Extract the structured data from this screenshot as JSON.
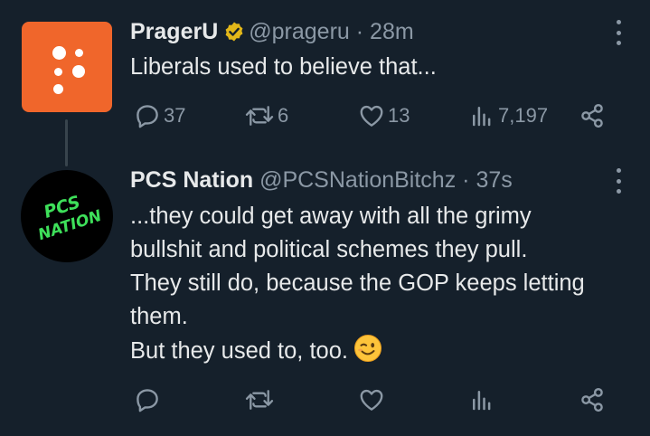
{
  "tweets": [
    {
      "name": "PragerU",
      "verified": true,
      "handle": "@prageru",
      "time": "28m",
      "text": [
        "Liberals used to believe that..."
      ],
      "stats": {
        "replies": "37",
        "retweets": "6",
        "likes": "13",
        "views": "7,197"
      },
      "avatar_color": "#f0662b"
    },
    {
      "name": "PCS Nation",
      "handle": "@PCSNationBitchz",
      "time": "37s",
      "text": [
        "...they could get away with all the grimy",
        "bullshit and political schemes they pull.",
        "They still do, because the GOP keeps letting",
        "them.",
        "But they used to, too."
      ],
      "emoji": "winking-face",
      "avatar_logo_text": [
        "PCS",
        "NATION"
      ],
      "avatar_logo_color": "#3ee05a"
    }
  ],
  "colors": {
    "background": "#15202b",
    "text": "#e7e9ea",
    "muted": "#8b98a5",
    "verified_badge": "#e2b719"
  }
}
